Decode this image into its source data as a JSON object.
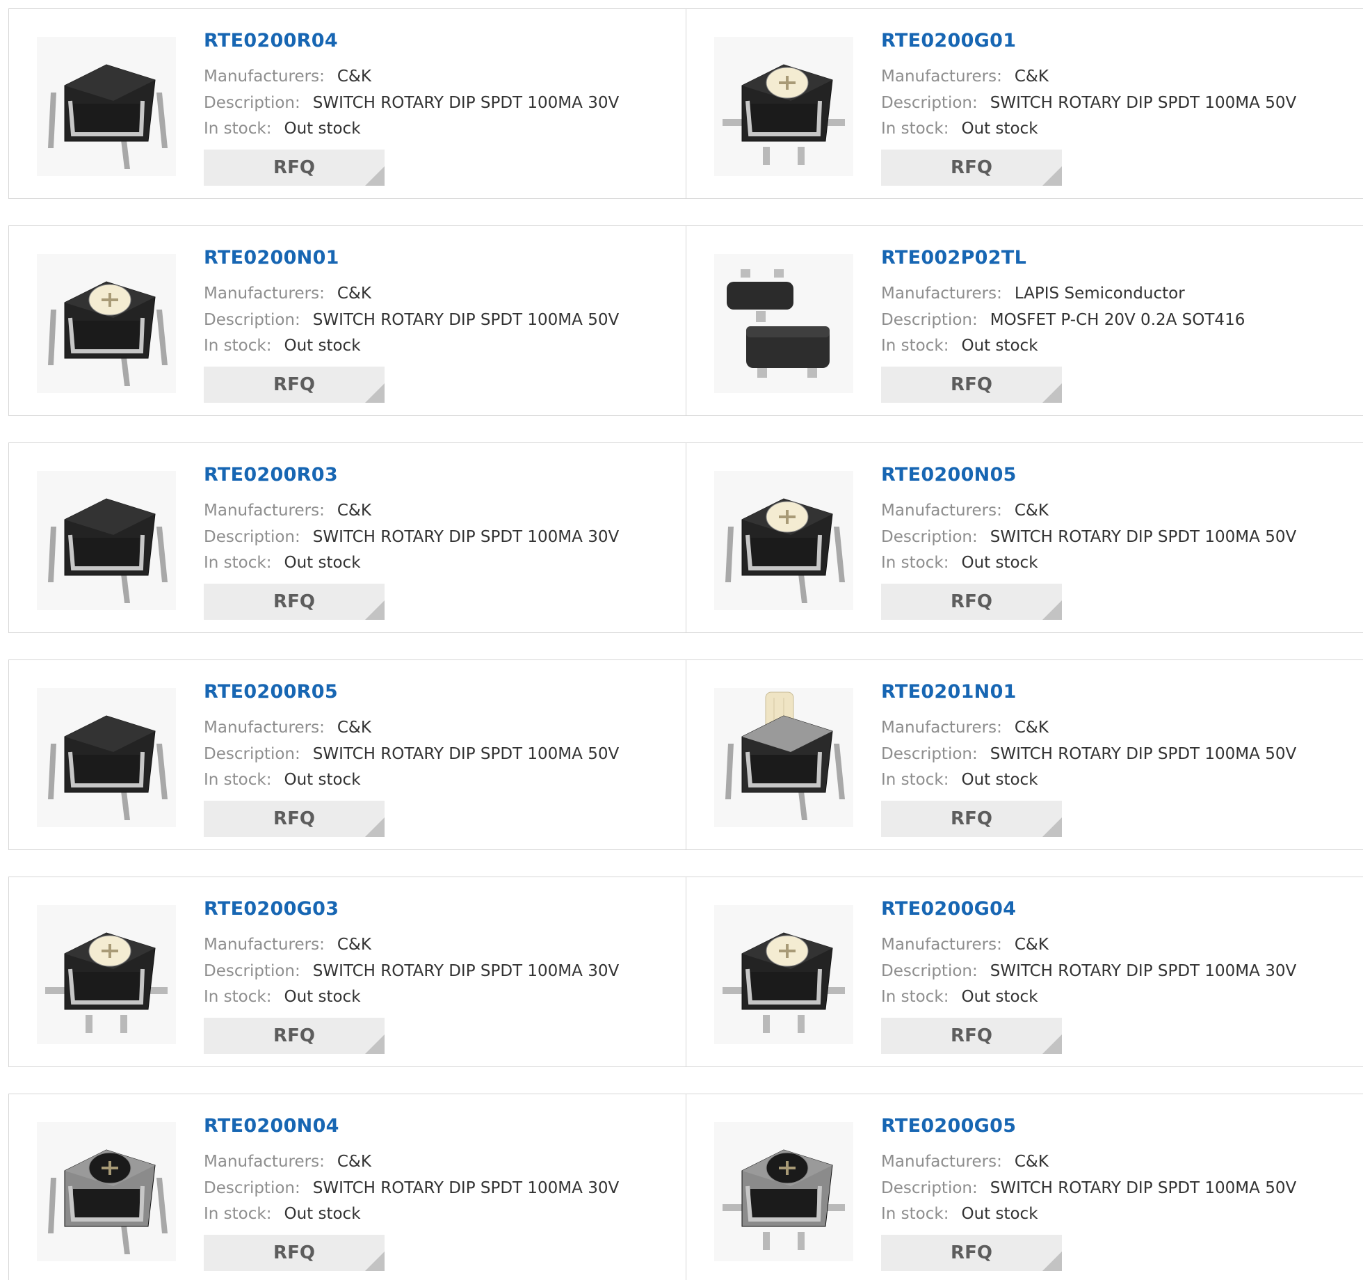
{
  "labels": {
    "manufacturers": "Manufacturers:",
    "description": "Description:",
    "in_stock": "In stock:",
    "rfq": "RFQ"
  },
  "colors": {
    "title": "#1766b3",
    "label": "#8e8e8e",
    "value": "#333333",
    "rfq_bg": "#ececec",
    "rfq_text": "#5d5d5d",
    "rfq_corner": "#c3c3c3",
    "border": "#d6d6d6"
  },
  "products": [
    {
      "part": "RTE0200R04",
      "manufacturer": "C&K",
      "description": "SWITCH ROTARY DIP SPDT 100MA 30V",
      "stock": "Out stock",
      "image": "rotary-switch-black-through-hole-icon"
    },
    {
      "part": "RTE0200G01",
      "manufacturer": "C&K",
      "description": "SWITCH ROTARY DIP SPDT 100MA 50V",
      "stock": "Out stock",
      "image": "rotary-switch-white-knob-smd-icon"
    },
    {
      "part": "RTE0200N01",
      "manufacturer": "C&K",
      "description": "SWITCH ROTARY DIP SPDT 100MA 50V",
      "stock": "Out stock",
      "image": "rotary-switch-white-knob-through-hole-icon"
    },
    {
      "part": "RTE002P02TL",
      "manufacturer": "LAPIS Semiconductor",
      "description": "MOSFET P-CH 20V 0.2A SOT416",
      "stock": "Out stock",
      "image": "sot416-mosfet-icon"
    },
    {
      "part": "RTE0200R03",
      "manufacturer": "C&K",
      "description": "SWITCH ROTARY DIP SPDT 100MA 30V",
      "stock": "Out stock",
      "image": "rotary-switch-black-through-hole-icon"
    },
    {
      "part": "RTE0200N05",
      "manufacturer": "C&K",
      "description": "SWITCH ROTARY DIP SPDT 100MA 50V",
      "stock": "Out stock",
      "image": "rotary-switch-white-knob-through-hole-icon"
    },
    {
      "part": "RTE0200R05",
      "manufacturer": "C&K",
      "description": "SWITCH ROTARY DIP SPDT 100MA 50V",
      "stock": "Out stock",
      "image": "rotary-switch-black-angled-icon"
    },
    {
      "part": "RTE0201N01",
      "manufacturer": "C&K",
      "description": "SWITCH ROTARY DIP SPDT 100MA 50V",
      "stock": "Out stock",
      "image": "rotary-switch-shaft-icon"
    },
    {
      "part": "RTE0200G03",
      "manufacturer": "C&K",
      "description": "SWITCH ROTARY DIP SPDT 100MA 30V",
      "stock": "Out stock",
      "image": "rotary-switch-white-knob-smd-icon"
    },
    {
      "part": "RTE0200G04",
      "manufacturer": "C&K",
      "description": "SWITCH ROTARY DIP SPDT 100MA 30V",
      "stock": "Out stock",
      "image": "rotary-switch-white-knob-smd-icon"
    },
    {
      "part": "RTE0200N04",
      "manufacturer": "C&K",
      "description": "SWITCH ROTARY DIP SPDT 100MA 30V",
      "stock": "Out stock",
      "image": "rotary-switch-metal-through-hole-icon"
    },
    {
      "part": "RTE0200G05",
      "manufacturer": "C&K",
      "description": "SWITCH ROTARY DIP SPDT 100MA 50V",
      "stock": "Out stock",
      "image": "rotary-switch-metal-smd-icon"
    }
  ]
}
